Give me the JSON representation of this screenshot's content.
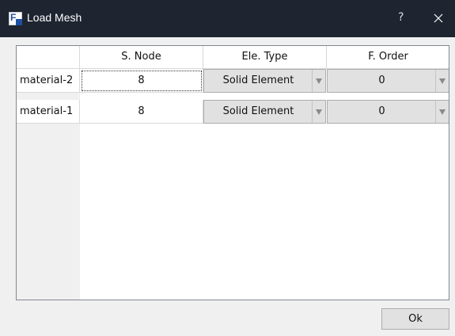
{
  "window": {
    "title": "Load Mesh",
    "help_label": "?",
    "close_label": "×"
  },
  "table": {
    "columns": [
      "S. Node",
      "Ele. Type",
      "F. Order"
    ],
    "rows": [
      {
        "label": "material-2",
        "s_node": "8",
        "ele_type": "Solid Element",
        "f_order": "0"
      },
      {
        "label": "material-1",
        "s_node": "8",
        "ele_type": "Solid Element",
        "f_order": "0"
      }
    ]
  },
  "buttons": {
    "ok_label": "Ok"
  },
  "icons": {
    "app": "app-icon",
    "dropdown": "chevron-down-icon",
    "close": "close-icon"
  }
}
